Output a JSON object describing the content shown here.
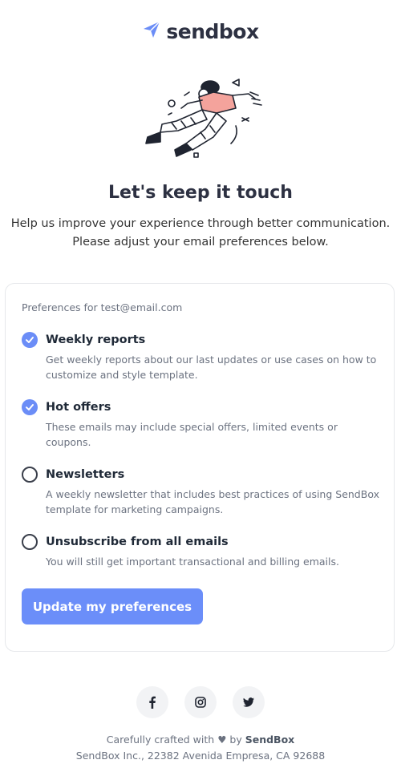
{
  "brand": {
    "name": "sendbox",
    "logo_icon": "paper-plane-icon",
    "accent": "#6b8df7"
  },
  "hero": {
    "title": "Let's keep it touch",
    "intro_line1": "Help us improve your experience through better communication.",
    "intro_line2": "Please adjust your email preferences below."
  },
  "preferences": {
    "label": "Preferences for test@email.com",
    "options": [
      {
        "title": "Weekly reports",
        "checked": true,
        "desc1": "Get weekly reports about our last updates or use cases on how to",
        "desc2": "customize and style template."
      },
      {
        "title": "Hot offers",
        "checked": true,
        "desc1": "These emails may include special offers, limited events or",
        "desc2": "coupons."
      },
      {
        "title": "Newsletters",
        "checked": false,
        "desc1": "A weekly newsletter that includes best practices of using SendBox",
        "desc2": "template for marketing campaigns."
      },
      {
        "title": "Unsubscribe from all emails",
        "checked": false,
        "desc1": "You will still get important transactional and billing emails.",
        "desc2": ""
      }
    ],
    "button_label": "Update my preferences"
  },
  "social": {
    "icons": [
      "facebook-icon",
      "instagram-icon",
      "twitter-icon"
    ]
  },
  "footer": {
    "crafted_prefix": "Carefully crafted with",
    "crafted_by": "by",
    "brand": "SendBox",
    "address": "SendBox Inc., 22382 Avenida Empresa, CA 92688"
  }
}
